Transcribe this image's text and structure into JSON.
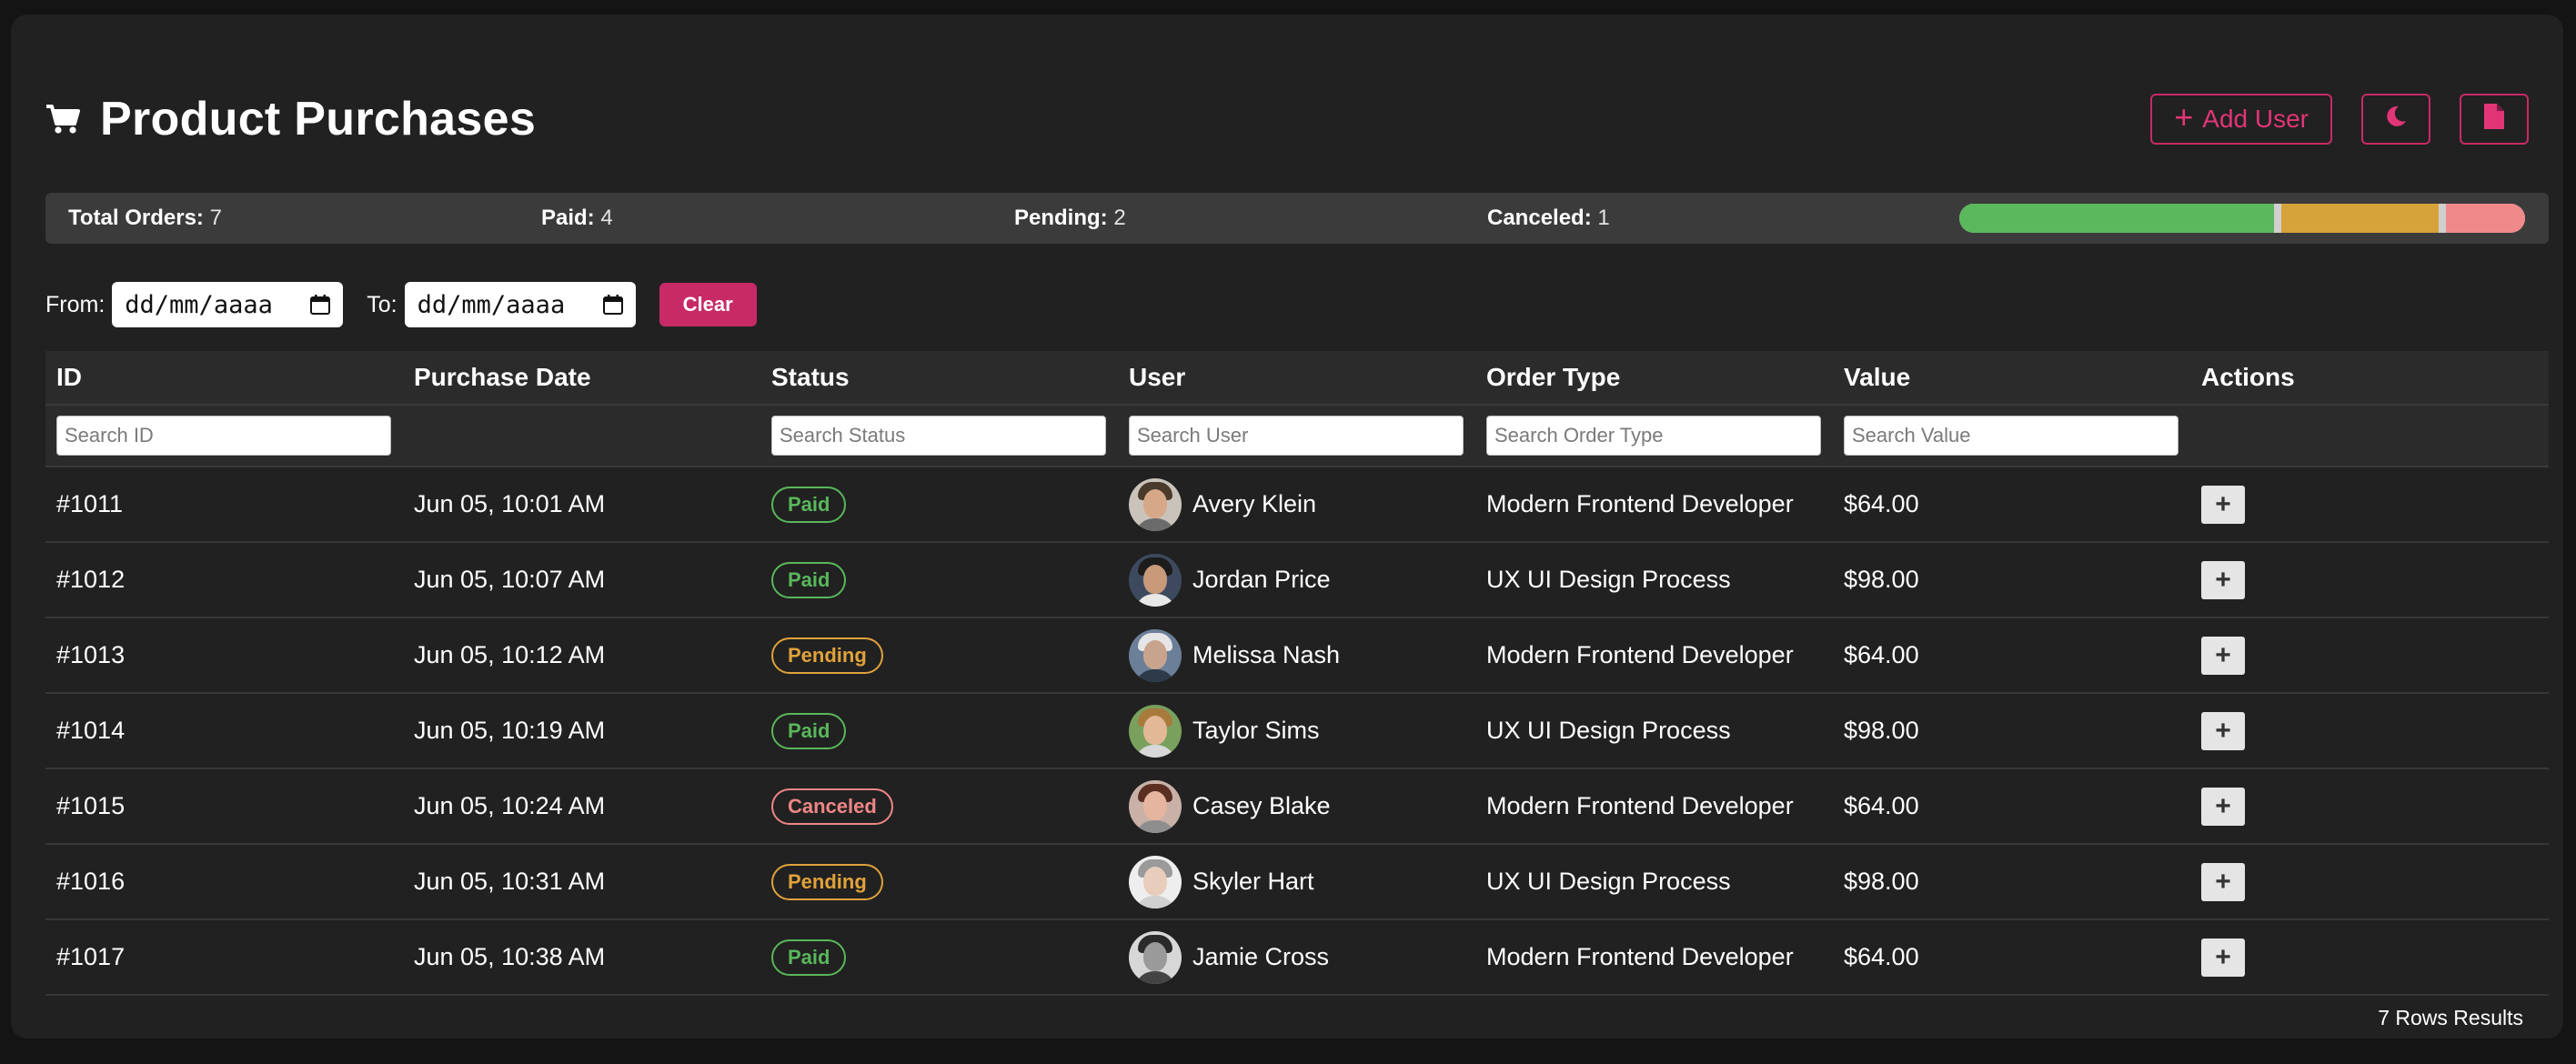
{
  "header": {
    "title": "Product Purchases",
    "title_icon": "cart-icon",
    "add_user_label": "Add User",
    "add_user_icon": "plus-icon",
    "theme_icon": "moon-icon",
    "export_icon": "file-icon"
  },
  "summary": {
    "total_label": "Total Orders:",
    "total_value": "7",
    "paid_label": "Paid:",
    "paid_value": "4",
    "pending_label": "Pending:",
    "pending_value": "2",
    "canceled_label": "Canceled:",
    "canceled_value": "1",
    "progress": {
      "paid": 4,
      "pending": 2,
      "canceled": 1
    },
    "colors": {
      "paid": "#5bb85d",
      "pending": "#d6a23a",
      "canceled": "#f08a8a"
    }
  },
  "filters": {
    "from_label": "From:",
    "from_value": "dd/mm/aaaa",
    "to_label": "To:",
    "to_value": "dd/mm/aaaa",
    "clear_label": "Clear"
  },
  "table": {
    "columns": [
      "ID",
      "Purchase Date",
      "Status",
      "User",
      "Order Type",
      "Value",
      "Actions"
    ],
    "search_placeholders": {
      "id": "Search ID",
      "status": "Search Status",
      "user": "Search User",
      "order_type": "Search Order Type",
      "value": "Search Value"
    },
    "rows": [
      {
        "id": "#1011",
        "date": "Jun 05, 10:01 AM",
        "status": "Paid",
        "user": "Avery Klein",
        "order_type": "Modern Frontend Developer",
        "value": "$64.00",
        "action": "+"
      },
      {
        "id": "#1012",
        "date": "Jun 05, 10:07 AM",
        "status": "Paid",
        "user": "Jordan Price",
        "order_type": "UX UI Design Process",
        "value": "$98.00",
        "action": "+"
      },
      {
        "id": "#1013",
        "date": "Jun 05, 10:12 AM",
        "status": "Pending",
        "user": "Melissa Nash",
        "order_type": "Modern Frontend Developer",
        "value": "$64.00",
        "action": "+"
      },
      {
        "id": "#1014",
        "date": "Jun 05, 10:19 AM",
        "status": "Paid",
        "user": "Taylor Sims",
        "order_type": "UX UI Design Process",
        "value": "$98.00",
        "action": "+"
      },
      {
        "id": "#1015",
        "date": "Jun 05, 10:24 AM",
        "status": "Canceled",
        "user": "Casey Blake",
        "order_type": "Modern Frontend Developer",
        "value": "$64.00",
        "action": "+"
      },
      {
        "id": "#1016",
        "date": "Jun 05, 10:31 AM",
        "status": "Pending",
        "user": "Skyler Hart",
        "order_type": "UX UI Design Process",
        "value": "$98.00",
        "action": "+"
      },
      {
        "id": "#1017",
        "date": "Jun 05, 10:38 AM",
        "status": "Paid",
        "user": "Jamie Cross",
        "order_type": "Modern Frontend Developer",
        "value": "$64.00",
        "action": "+"
      }
    ]
  },
  "footer": {
    "results": "7 Rows Results"
  }
}
